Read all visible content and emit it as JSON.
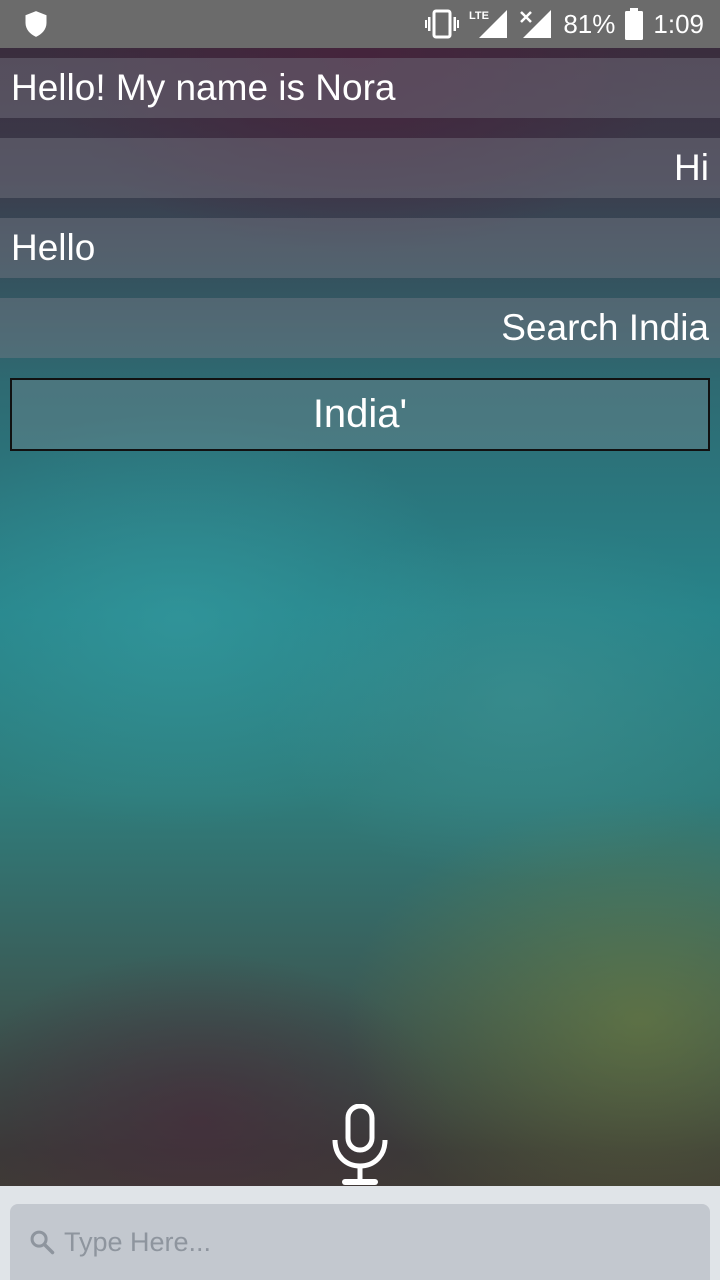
{
  "status_bar": {
    "battery_percent": "81%",
    "time": "1:09",
    "network": "LTE",
    "icons": [
      "shield-icon",
      "vibrate-icon",
      "lte-signal-icon",
      "no-signal-icon",
      "battery-icon"
    ]
  },
  "chat": {
    "messages": [
      {
        "text": "Hello! My name is Nora",
        "side": "left"
      },
      {
        "text": "Hi",
        "side": "right"
      },
      {
        "text": "Hello",
        "side": "left"
      },
      {
        "text": "Search India",
        "side": "right"
      }
    ]
  },
  "result": {
    "text": "India'"
  },
  "input": {
    "placeholder": "Type Here...",
    "value": ""
  },
  "icons": {
    "mic": "microphone-icon",
    "search": "search-icon"
  }
}
